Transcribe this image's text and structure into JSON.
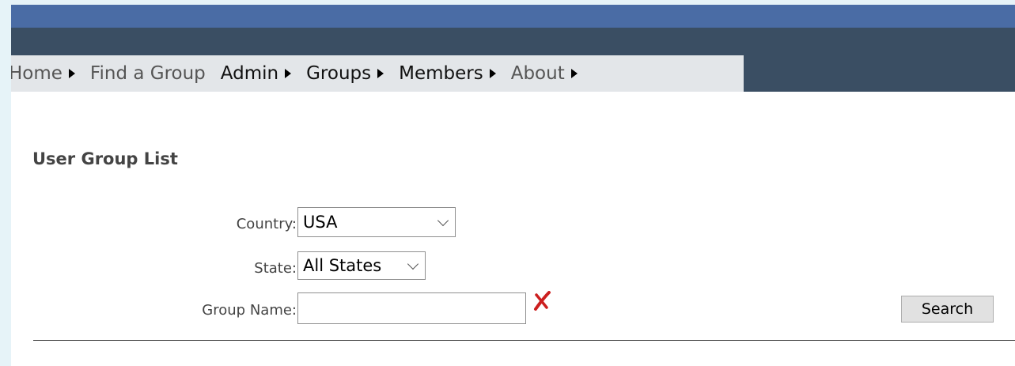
{
  "nav": {
    "items": [
      {
        "label": "Home",
        "has_submenu": true
      },
      {
        "label": "Find a Group",
        "has_submenu": false
      },
      {
        "label": "Admin",
        "has_submenu": true
      },
      {
        "label": "Groups",
        "has_submenu": true
      },
      {
        "label": "Members",
        "has_submenu": true
      },
      {
        "label": "About",
        "has_submenu": true
      }
    ]
  },
  "page": {
    "title": "User Group List"
  },
  "form": {
    "country_label": "Country:",
    "country_value": "USA",
    "state_label": "State:",
    "state_value": "All States",
    "group_name_label": "Group Name:",
    "group_name_value": "",
    "search_label": "Search"
  },
  "colors": {
    "header_blue": "#4a6ca5",
    "header_dark": "#3a4e63",
    "nav_bg": "#e3e6e9",
    "clear_icon": "#cc1f1f"
  }
}
